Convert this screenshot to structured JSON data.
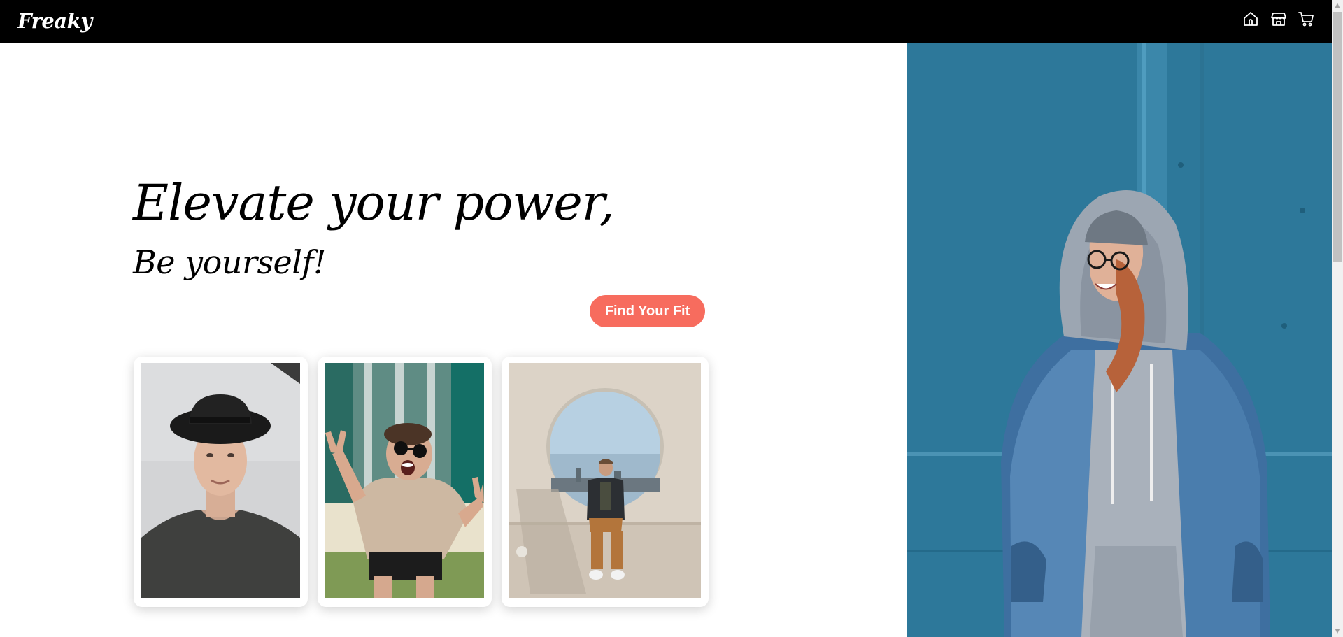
{
  "header": {
    "brand": "Freaky",
    "icons": [
      "home-icon",
      "store-icon",
      "cart-icon"
    ]
  },
  "hero": {
    "headline": "Elevate your power,",
    "subline": "Be yourself!",
    "cta_label": "Find Your Fit"
  },
  "gallery": {
    "photos": [
      "man-in-black-hat-photo",
      "woman-with-sunglasses-peace-sign-photo",
      "man-sitting-by-circular-window-photo"
    ]
  },
  "feature_photo": "woman-in-hoodie-denim-jacket-photo",
  "colors": {
    "header_bg": "#000000",
    "cta_bg": "#f76c5e",
    "cta_text": "#ffffff",
    "wall_blue": "#2f7da0"
  }
}
